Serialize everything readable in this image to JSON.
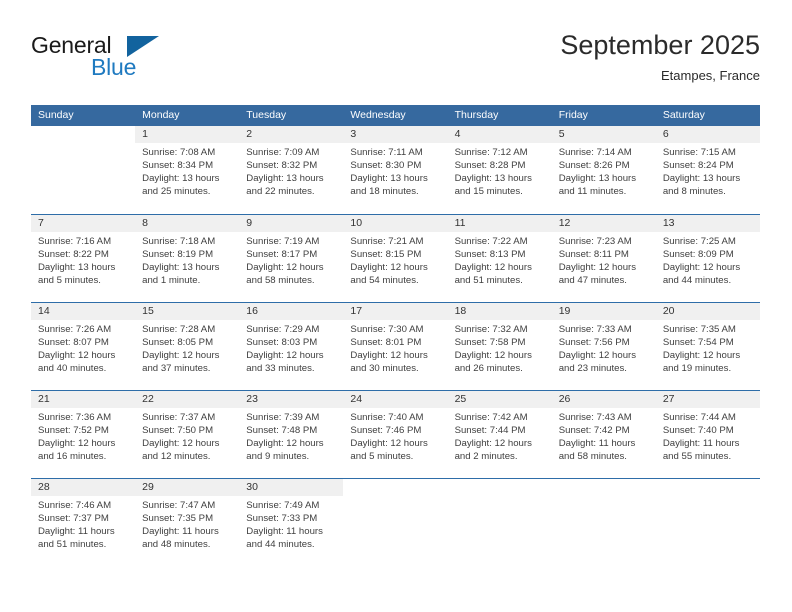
{
  "brand": {
    "name_part1": "General",
    "name_part2": "Blue",
    "logo_icon": "triangle-logo-icon"
  },
  "header": {
    "title": "September 2025",
    "subtitle": "Etampes, France"
  },
  "calendar": {
    "weekday_headers": [
      "Sunday",
      "Monday",
      "Tuesday",
      "Wednesday",
      "Thursday",
      "Friday",
      "Saturday"
    ],
    "accent_color": "#36699f",
    "separator_color": "#2e6da8",
    "daynum_band_color": "#f0f0f0",
    "weeks": [
      [
        {
          "day": "",
          "sunrise": "",
          "sunset": "",
          "daylight_line1": "",
          "daylight_line2": "",
          "empty": true
        },
        {
          "day": "1",
          "sunrise": "Sunrise: 7:08 AM",
          "sunset": "Sunset: 8:34 PM",
          "daylight_line1": "Daylight: 13 hours",
          "daylight_line2": "and 25 minutes.",
          "empty": false
        },
        {
          "day": "2",
          "sunrise": "Sunrise: 7:09 AM",
          "sunset": "Sunset: 8:32 PM",
          "daylight_line1": "Daylight: 13 hours",
          "daylight_line2": "and 22 minutes.",
          "empty": false
        },
        {
          "day": "3",
          "sunrise": "Sunrise: 7:11 AM",
          "sunset": "Sunset: 8:30 PM",
          "daylight_line1": "Daylight: 13 hours",
          "daylight_line2": "and 18 minutes.",
          "empty": false
        },
        {
          "day": "4",
          "sunrise": "Sunrise: 7:12 AM",
          "sunset": "Sunset: 8:28 PM",
          "daylight_line1": "Daylight: 13 hours",
          "daylight_line2": "and 15 minutes.",
          "empty": false
        },
        {
          "day": "5",
          "sunrise": "Sunrise: 7:14 AM",
          "sunset": "Sunset: 8:26 PM",
          "daylight_line1": "Daylight: 13 hours",
          "daylight_line2": "and 11 minutes.",
          "empty": false
        },
        {
          "day": "6",
          "sunrise": "Sunrise: 7:15 AM",
          "sunset": "Sunset: 8:24 PM",
          "daylight_line1": "Daylight: 13 hours",
          "daylight_line2": "and 8 minutes.",
          "empty": false
        }
      ],
      [
        {
          "day": "7",
          "sunrise": "Sunrise: 7:16 AM",
          "sunset": "Sunset: 8:22 PM",
          "daylight_line1": "Daylight: 13 hours",
          "daylight_line2": "and 5 minutes.",
          "empty": false
        },
        {
          "day": "8",
          "sunrise": "Sunrise: 7:18 AM",
          "sunset": "Sunset: 8:19 PM",
          "daylight_line1": "Daylight: 13 hours",
          "daylight_line2": "and 1 minute.",
          "empty": false
        },
        {
          "day": "9",
          "sunrise": "Sunrise: 7:19 AM",
          "sunset": "Sunset: 8:17 PM",
          "daylight_line1": "Daylight: 12 hours",
          "daylight_line2": "and 58 minutes.",
          "empty": false
        },
        {
          "day": "10",
          "sunrise": "Sunrise: 7:21 AM",
          "sunset": "Sunset: 8:15 PM",
          "daylight_line1": "Daylight: 12 hours",
          "daylight_line2": "and 54 minutes.",
          "empty": false
        },
        {
          "day": "11",
          "sunrise": "Sunrise: 7:22 AM",
          "sunset": "Sunset: 8:13 PM",
          "daylight_line1": "Daylight: 12 hours",
          "daylight_line2": "and 51 minutes.",
          "empty": false
        },
        {
          "day": "12",
          "sunrise": "Sunrise: 7:23 AM",
          "sunset": "Sunset: 8:11 PM",
          "daylight_line1": "Daylight: 12 hours",
          "daylight_line2": "and 47 minutes.",
          "empty": false
        },
        {
          "day": "13",
          "sunrise": "Sunrise: 7:25 AM",
          "sunset": "Sunset: 8:09 PM",
          "daylight_line1": "Daylight: 12 hours",
          "daylight_line2": "and 44 minutes.",
          "empty": false
        }
      ],
      [
        {
          "day": "14",
          "sunrise": "Sunrise: 7:26 AM",
          "sunset": "Sunset: 8:07 PM",
          "daylight_line1": "Daylight: 12 hours",
          "daylight_line2": "and 40 minutes.",
          "empty": false
        },
        {
          "day": "15",
          "sunrise": "Sunrise: 7:28 AM",
          "sunset": "Sunset: 8:05 PM",
          "daylight_line1": "Daylight: 12 hours",
          "daylight_line2": "and 37 minutes.",
          "empty": false
        },
        {
          "day": "16",
          "sunrise": "Sunrise: 7:29 AM",
          "sunset": "Sunset: 8:03 PM",
          "daylight_line1": "Daylight: 12 hours",
          "daylight_line2": "and 33 minutes.",
          "empty": false
        },
        {
          "day": "17",
          "sunrise": "Sunrise: 7:30 AM",
          "sunset": "Sunset: 8:01 PM",
          "daylight_line1": "Daylight: 12 hours",
          "daylight_line2": "and 30 minutes.",
          "empty": false
        },
        {
          "day": "18",
          "sunrise": "Sunrise: 7:32 AM",
          "sunset": "Sunset: 7:58 PM",
          "daylight_line1": "Daylight: 12 hours",
          "daylight_line2": "and 26 minutes.",
          "empty": false
        },
        {
          "day": "19",
          "sunrise": "Sunrise: 7:33 AM",
          "sunset": "Sunset: 7:56 PM",
          "daylight_line1": "Daylight: 12 hours",
          "daylight_line2": "and 23 minutes.",
          "empty": false
        },
        {
          "day": "20",
          "sunrise": "Sunrise: 7:35 AM",
          "sunset": "Sunset: 7:54 PM",
          "daylight_line1": "Daylight: 12 hours",
          "daylight_line2": "and 19 minutes.",
          "empty": false
        }
      ],
      [
        {
          "day": "21",
          "sunrise": "Sunrise: 7:36 AM",
          "sunset": "Sunset: 7:52 PM",
          "daylight_line1": "Daylight: 12 hours",
          "daylight_line2": "and 16 minutes.",
          "empty": false
        },
        {
          "day": "22",
          "sunrise": "Sunrise: 7:37 AM",
          "sunset": "Sunset: 7:50 PM",
          "daylight_line1": "Daylight: 12 hours",
          "daylight_line2": "and 12 minutes.",
          "empty": false
        },
        {
          "day": "23",
          "sunrise": "Sunrise: 7:39 AM",
          "sunset": "Sunset: 7:48 PM",
          "daylight_line1": "Daylight: 12 hours",
          "daylight_line2": "and 9 minutes.",
          "empty": false
        },
        {
          "day": "24",
          "sunrise": "Sunrise: 7:40 AM",
          "sunset": "Sunset: 7:46 PM",
          "daylight_line1": "Daylight: 12 hours",
          "daylight_line2": "and 5 minutes.",
          "empty": false
        },
        {
          "day": "25",
          "sunrise": "Sunrise: 7:42 AM",
          "sunset": "Sunset: 7:44 PM",
          "daylight_line1": "Daylight: 12 hours",
          "daylight_line2": "and 2 minutes.",
          "empty": false
        },
        {
          "day": "26",
          "sunrise": "Sunrise: 7:43 AM",
          "sunset": "Sunset: 7:42 PM",
          "daylight_line1": "Daylight: 11 hours",
          "daylight_line2": "and 58 minutes.",
          "empty": false
        },
        {
          "day": "27",
          "sunrise": "Sunrise: 7:44 AM",
          "sunset": "Sunset: 7:40 PM",
          "daylight_line1": "Daylight: 11 hours",
          "daylight_line2": "and 55 minutes.",
          "empty": false
        }
      ],
      [
        {
          "day": "28",
          "sunrise": "Sunrise: 7:46 AM",
          "sunset": "Sunset: 7:37 PM",
          "daylight_line1": "Daylight: 11 hours",
          "daylight_line2": "and 51 minutes.",
          "empty": false
        },
        {
          "day": "29",
          "sunrise": "Sunrise: 7:47 AM",
          "sunset": "Sunset: 7:35 PM",
          "daylight_line1": "Daylight: 11 hours",
          "daylight_line2": "and 48 minutes.",
          "empty": false
        },
        {
          "day": "30",
          "sunrise": "Sunrise: 7:49 AM",
          "sunset": "Sunset: 7:33 PM",
          "daylight_line1": "Daylight: 11 hours",
          "daylight_line2": "and 44 minutes.",
          "empty": false
        },
        {
          "day": "",
          "sunrise": "",
          "sunset": "",
          "daylight_line1": "",
          "daylight_line2": "",
          "empty": true
        },
        {
          "day": "",
          "sunrise": "",
          "sunset": "",
          "daylight_line1": "",
          "daylight_line2": "",
          "empty": true
        },
        {
          "day": "",
          "sunrise": "",
          "sunset": "",
          "daylight_line1": "",
          "daylight_line2": "",
          "empty": true
        },
        {
          "day": "",
          "sunrise": "",
          "sunset": "",
          "daylight_line1": "",
          "daylight_line2": "",
          "empty": true
        }
      ]
    ]
  }
}
